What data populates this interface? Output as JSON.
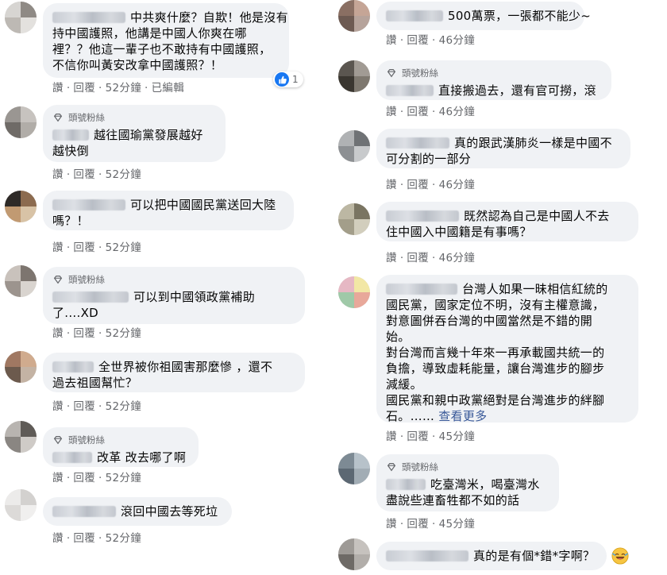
{
  "ui": {
    "badge": "頭號粉絲",
    "read": "讚",
    "reply": "回覆",
    "dot": "·",
    "edited": "已編輯",
    "see_more": "查看更多",
    "like_count": "1"
  },
  "colors": {
    "bubble": "#f0f2f5",
    "meta": "#65676b",
    "link": "#385898",
    "like_blue": "#1877f2"
  },
  "left": [
    {
      "lines": [
        "中共爽什麼？自欺！他是沒有",
        "持中國護照，他講是中國人你爽在哪",
        "裡？？他這一輩子也不敢持有中國護照，",
        "不信你叫黃安改拿中國護照？！"
      ],
      "time": "52分鐘",
      "edited": true
    },
    {
      "badge": true,
      "lines": [
        "越往國瑜黨發展越好",
        "越快倒"
      ],
      "time": "52分鐘"
    },
    {
      "lines": [
        "可以把中國國民黨送回大陸",
        "嗎？！"
      ],
      "time": "52分鐘"
    },
    {
      "badge": true,
      "lines": [
        "可以到中國領政黨補助",
        "了....XD"
      ],
      "time": "52分鐘"
    },
    {
      "lines": [
        "全世界被你祖國害那麼慘 ，還不",
        "過去祖國幫忙？"
      ],
      "time": "52分鐘"
    },
    {
      "badge": true,
      "lines": [
        "改革 改去哪了啊"
      ],
      "time": "52分鐘"
    },
    {
      "lines": [
        "滾回中國去等死垃"
      ],
      "time": "52分鐘"
    }
  ],
  "right": [
    {
      "lines": [
        "500萬票，一張都不能少~"
      ],
      "time": "46分鐘"
    },
    {
      "badge": true,
      "lines": [
        "直接搬過去，還有官可撈，滾"
      ],
      "time": "46分鐘"
    },
    {
      "lines": [
        "真的跟武漢肺炎一樣是中國不",
        "可分割的一部分"
      ],
      "time": "46分鐘"
    },
    {
      "lines": [
        "既然認為自己是中國人不去",
        "住中國入中國籍是有事嗎？"
      ],
      "time": "46分鐘"
    },
    {
      "lines": [
        "台灣人如果一昧相信紅統的",
        "國民黨，國家定位不明，沒有主權意識，",
        "對意圖併吞台灣的中國當然是不錯的開",
        "始。",
        "對台灣而言幾十年來一再承載國共統一的",
        "負擔，導致虛耗能量，讓台灣進步的腳步",
        "減緩。",
        "國民黨和親中政黨絕對是台灣進步的絆腳",
        "石。……"
      ],
      "time": "45分鐘",
      "see_more": true
    },
    {
      "badge": true,
      "lines": [
        "吃臺灣米，喝臺灣水",
        "盡說些連畜牲都不如的話"
      ],
      "time": "45分鐘"
    },
    {
      "lines": [
        "真的是有個*錯*字啊？"
      ],
      "time": "",
      "emoji": "laughing-face-emoji"
    }
  ]
}
